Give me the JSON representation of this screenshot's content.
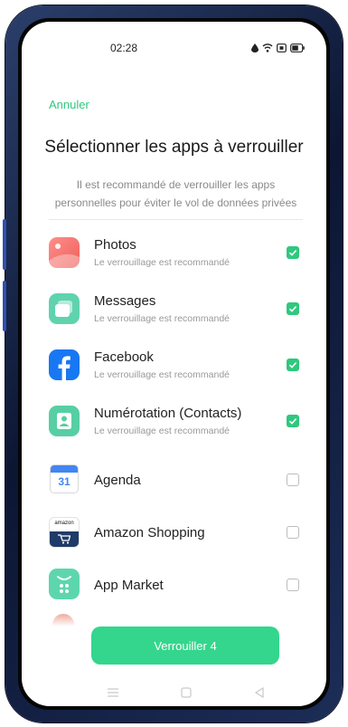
{
  "status_bar": {
    "time": "02:28",
    "icons": [
      "water-drop-icon",
      "wifi-icon",
      "sim-icon",
      "battery-icon"
    ]
  },
  "header": {
    "cancel_label": "Annuler",
    "title": "Sélectionner les apps à verrouiller",
    "subtitle": "Il est recommandé de verrouiller les apps personnelles pour éviter le vol de données privées"
  },
  "apps": [
    {
      "name": "Photos",
      "subtitle": "Le verrouillage est recommandé",
      "checked": true,
      "icon": "photos-icon"
    },
    {
      "name": "Messages",
      "subtitle": "Le verrouillage est recommandé",
      "checked": true,
      "icon": "messages-icon"
    },
    {
      "name": "Facebook",
      "subtitle": "Le verrouillage est recommandé",
      "checked": true,
      "icon": "facebook-icon"
    },
    {
      "name": "Numérotation (Contacts)",
      "subtitle": "Le verrouillage est recommandé",
      "checked": true,
      "icon": "contacts-icon"
    },
    {
      "name": "Agenda",
      "checked": false,
      "icon": "calendar-icon",
      "badge": "31"
    },
    {
      "name": "Amazon Shopping",
      "checked": false,
      "icon": "amazon-icon",
      "badge": "amazon"
    },
    {
      "name": "App Market",
      "checked": false,
      "icon": "app-market-icon"
    }
  ],
  "action": {
    "label": "Verrouiller 4"
  },
  "colors": {
    "accent": "#2fc87d",
    "button": "#33d68c"
  },
  "navbar": {
    "icons": [
      "menu-icon",
      "home-icon",
      "back-icon"
    ]
  }
}
